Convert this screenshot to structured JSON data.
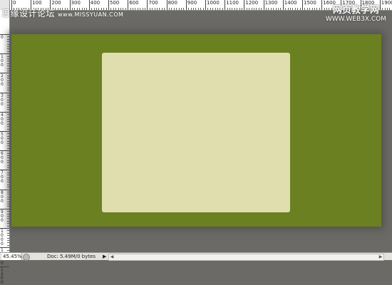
{
  "rulers": {
    "horizontal_labels": [
      "0",
      "100",
      "200",
      "300",
      "400",
      "500",
      "600",
      "700",
      "800",
      "900",
      "1000",
      "1100",
      "1200",
      "1300",
      "1400",
      "1500",
      "1600",
      "1700",
      "1800",
      "1900"
    ],
    "vertical_labels": [
      "0",
      "100",
      "200",
      "300",
      "400",
      "500",
      "600",
      "700",
      "800",
      "900",
      "1000",
      "1100",
      "1200"
    ]
  },
  "watermarks": {
    "left_text": "思缘设计论坛",
    "left_url": "www.MISSYUAN.COM",
    "right_title": "网页教学网",
    "right_url": "WWW.WEB3X.COM"
  },
  "status_bar": {
    "zoom": "45.45%",
    "doc_info": "Doc: 5.49M/0 bytes",
    "arrow": "▶"
  },
  "colors": {
    "workspace": "#6b6a66",
    "document_background": "#6a8021",
    "panel": "#e0deae"
  }
}
